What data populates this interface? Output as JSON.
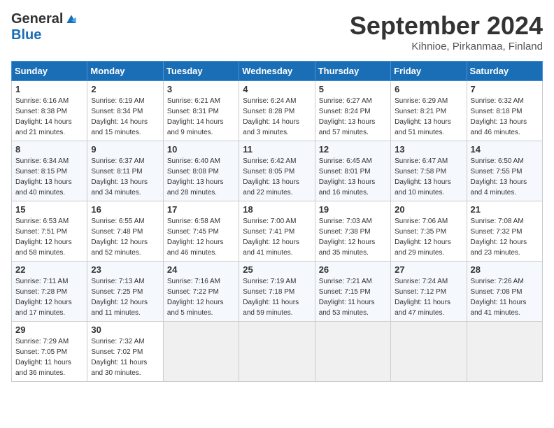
{
  "logo": {
    "general": "General",
    "blue": "Blue"
  },
  "header": {
    "title": "September 2024",
    "subtitle": "Kihnioe, Pirkanmaa, Finland"
  },
  "weekdays": [
    "Sunday",
    "Monday",
    "Tuesday",
    "Wednesday",
    "Thursday",
    "Friday",
    "Saturday"
  ],
  "weeks": [
    [
      {
        "day": "1",
        "sunrise": "Sunrise: 6:16 AM",
        "sunset": "Sunset: 8:38 PM",
        "daylight": "Daylight: 14 hours and 21 minutes."
      },
      {
        "day": "2",
        "sunrise": "Sunrise: 6:19 AM",
        "sunset": "Sunset: 8:34 PM",
        "daylight": "Daylight: 14 hours and 15 minutes."
      },
      {
        "day": "3",
        "sunrise": "Sunrise: 6:21 AM",
        "sunset": "Sunset: 8:31 PM",
        "daylight": "Daylight: 14 hours and 9 minutes."
      },
      {
        "day": "4",
        "sunrise": "Sunrise: 6:24 AM",
        "sunset": "Sunset: 8:28 PM",
        "daylight": "Daylight: 14 hours and 3 minutes."
      },
      {
        "day": "5",
        "sunrise": "Sunrise: 6:27 AM",
        "sunset": "Sunset: 8:24 PM",
        "daylight": "Daylight: 13 hours and 57 minutes."
      },
      {
        "day": "6",
        "sunrise": "Sunrise: 6:29 AM",
        "sunset": "Sunset: 8:21 PM",
        "daylight": "Daylight: 13 hours and 51 minutes."
      },
      {
        "day": "7",
        "sunrise": "Sunrise: 6:32 AM",
        "sunset": "Sunset: 8:18 PM",
        "daylight": "Daylight: 13 hours and 46 minutes."
      }
    ],
    [
      {
        "day": "8",
        "sunrise": "Sunrise: 6:34 AM",
        "sunset": "Sunset: 8:15 PM",
        "daylight": "Daylight: 13 hours and 40 minutes."
      },
      {
        "day": "9",
        "sunrise": "Sunrise: 6:37 AM",
        "sunset": "Sunset: 8:11 PM",
        "daylight": "Daylight: 13 hours and 34 minutes."
      },
      {
        "day": "10",
        "sunrise": "Sunrise: 6:40 AM",
        "sunset": "Sunset: 8:08 PM",
        "daylight": "Daylight: 13 hours and 28 minutes."
      },
      {
        "day": "11",
        "sunrise": "Sunrise: 6:42 AM",
        "sunset": "Sunset: 8:05 PM",
        "daylight": "Daylight: 13 hours and 22 minutes."
      },
      {
        "day": "12",
        "sunrise": "Sunrise: 6:45 AM",
        "sunset": "Sunset: 8:01 PM",
        "daylight": "Daylight: 13 hours and 16 minutes."
      },
      {
        "day": "13",
        "sunrise": "Sunrise: 6:47 AM",
        "sunset": "Sunset: 7:58 PM",
        "daylight": "Daylight: 13 hours and 10 minutes."
      },
      {
        "day": "14",
        "sunrise": "Sunrise: 6:50 AM",
        "sunset": "Sunset: 7:55 PM",
        "daylight": "Daylight: 13 hours and 4 minutes."
      }
    ],
    [
      {
        "day": "15",
        "sunrise": "Sunrise: 6:53 AM",
        "sunset": "Sunset: 7:51 PM",
        "daylight": "Daylight: 12 hours and 58 minutes."
      },
      {
        "day": "16",
        "sunrise": "Sunrise: 6:55 AM",
        "sunset": "Sunset: 7:48 PM",
        "daylight": "Daylight: 12 hours and 52 minutes."
      },
      {
        "day": "17",
        "sunrise": "Sunrise: 6:58 AM",
        "sunset": "Sunset: 7:45 PM",
        "daylight": "Daylight: 12 hours and 46 minutes."
      },
      {
        "day": "18",
        "sunrise": "Sunrise: 7:00 AM",
        "sunset": "Sunset: 7:41 PM",
        "daylight": "Daylight: 12 hours and 41 minutes."
      },
      {
        "day": "19",
        "sunrise": "Sunrise: 7:03 AM",
        "sunset": "Sunset: 7:38 PM",
        "daylight": "Daylight: 12 hours and 35 minutes."
      },
      {
        "day": "20",
        "sunrise": "Sunrise: 7:06 AM",
        "sunset": "Sunset: 7:35 PM",
        "daylight": "Daylight: 12 hours and 29 minutes."
      },
      {
        "day": "21",
        "sunrise": "Sunrise: 7:08 AM",
        "sunset": "Sunset: 7:32 PM",
        "daylight": "Daylight: 12 hours and 23 minutes."
      }
    ],
    [
      {
        "day": "22",
        "sunrise": "Sunrise: 7:11 AM",
        "sunset": "Sunset: 7:28 PM",
        "daylight": "Daylight: 12 hours and 17 minutes."
      },
      {
        "day": "23",
        "sunrise": "Sunrise: 7:13 AM",
        "sunset": "Sunset: 7:25 PM",
        "daylight": "Daylight: 12 hours and 11 minutes."
      },
      {
        "day": "24",
        "sunrise": "Sunrise: 7:16 AM",
        "sunset": "Sunset: 7:22 PM",
        "daylight": "Daylight: 12 hours and 5 minutes."
      },
      {
        "day": "25",
        "sunrise": "Sunrise: 7:19 AM",
        "sunset": "Sunset: 7:18 PM",
        "daylight": "Daylight: 11 hours and 59 minutes."
      },
      {
        "day": "26",
        "sunrise": "Sunrise: 7:21 AM",
        "sunset": "Sunset: 7:15 PM",
        "daylight": "Daylight: 11 hours and 53 minutes."
      },
      {
        "day": "27",
        "sunrise": "Sunrise: 7:24 AM",
        "sunset": "Sunset: 7:12 PM",
        "daylight": "Daylight: 11 hours and 47 minutes."
      },
      {
        "day": "28",
        "sunrise": "Sunrise: 7:26 AM",
        "sunset": "Sunset: 7:08 PM",
        "daylight": "Daylight: 11 hours and 41 minutes."
      }
    ],
    [
      {
        "day": "29",
        "sunrise": "Sunrise: 7:29 AM",
        "sunset": "Sunset: 7:05 PM",
        "daylight": "Daylight: 11 hours and 36 minutes."
      },
      {
        "day": "30",
        "sunrise": "Sunrise: 7:32 AM",
        "sunset": "Sunset: 7:02 PM",
        "daylight": "Daylight: 11 hours and 30 minutes."
      },
      null,
      null,
      null,
      null,
      null
    ]
  ]
}
